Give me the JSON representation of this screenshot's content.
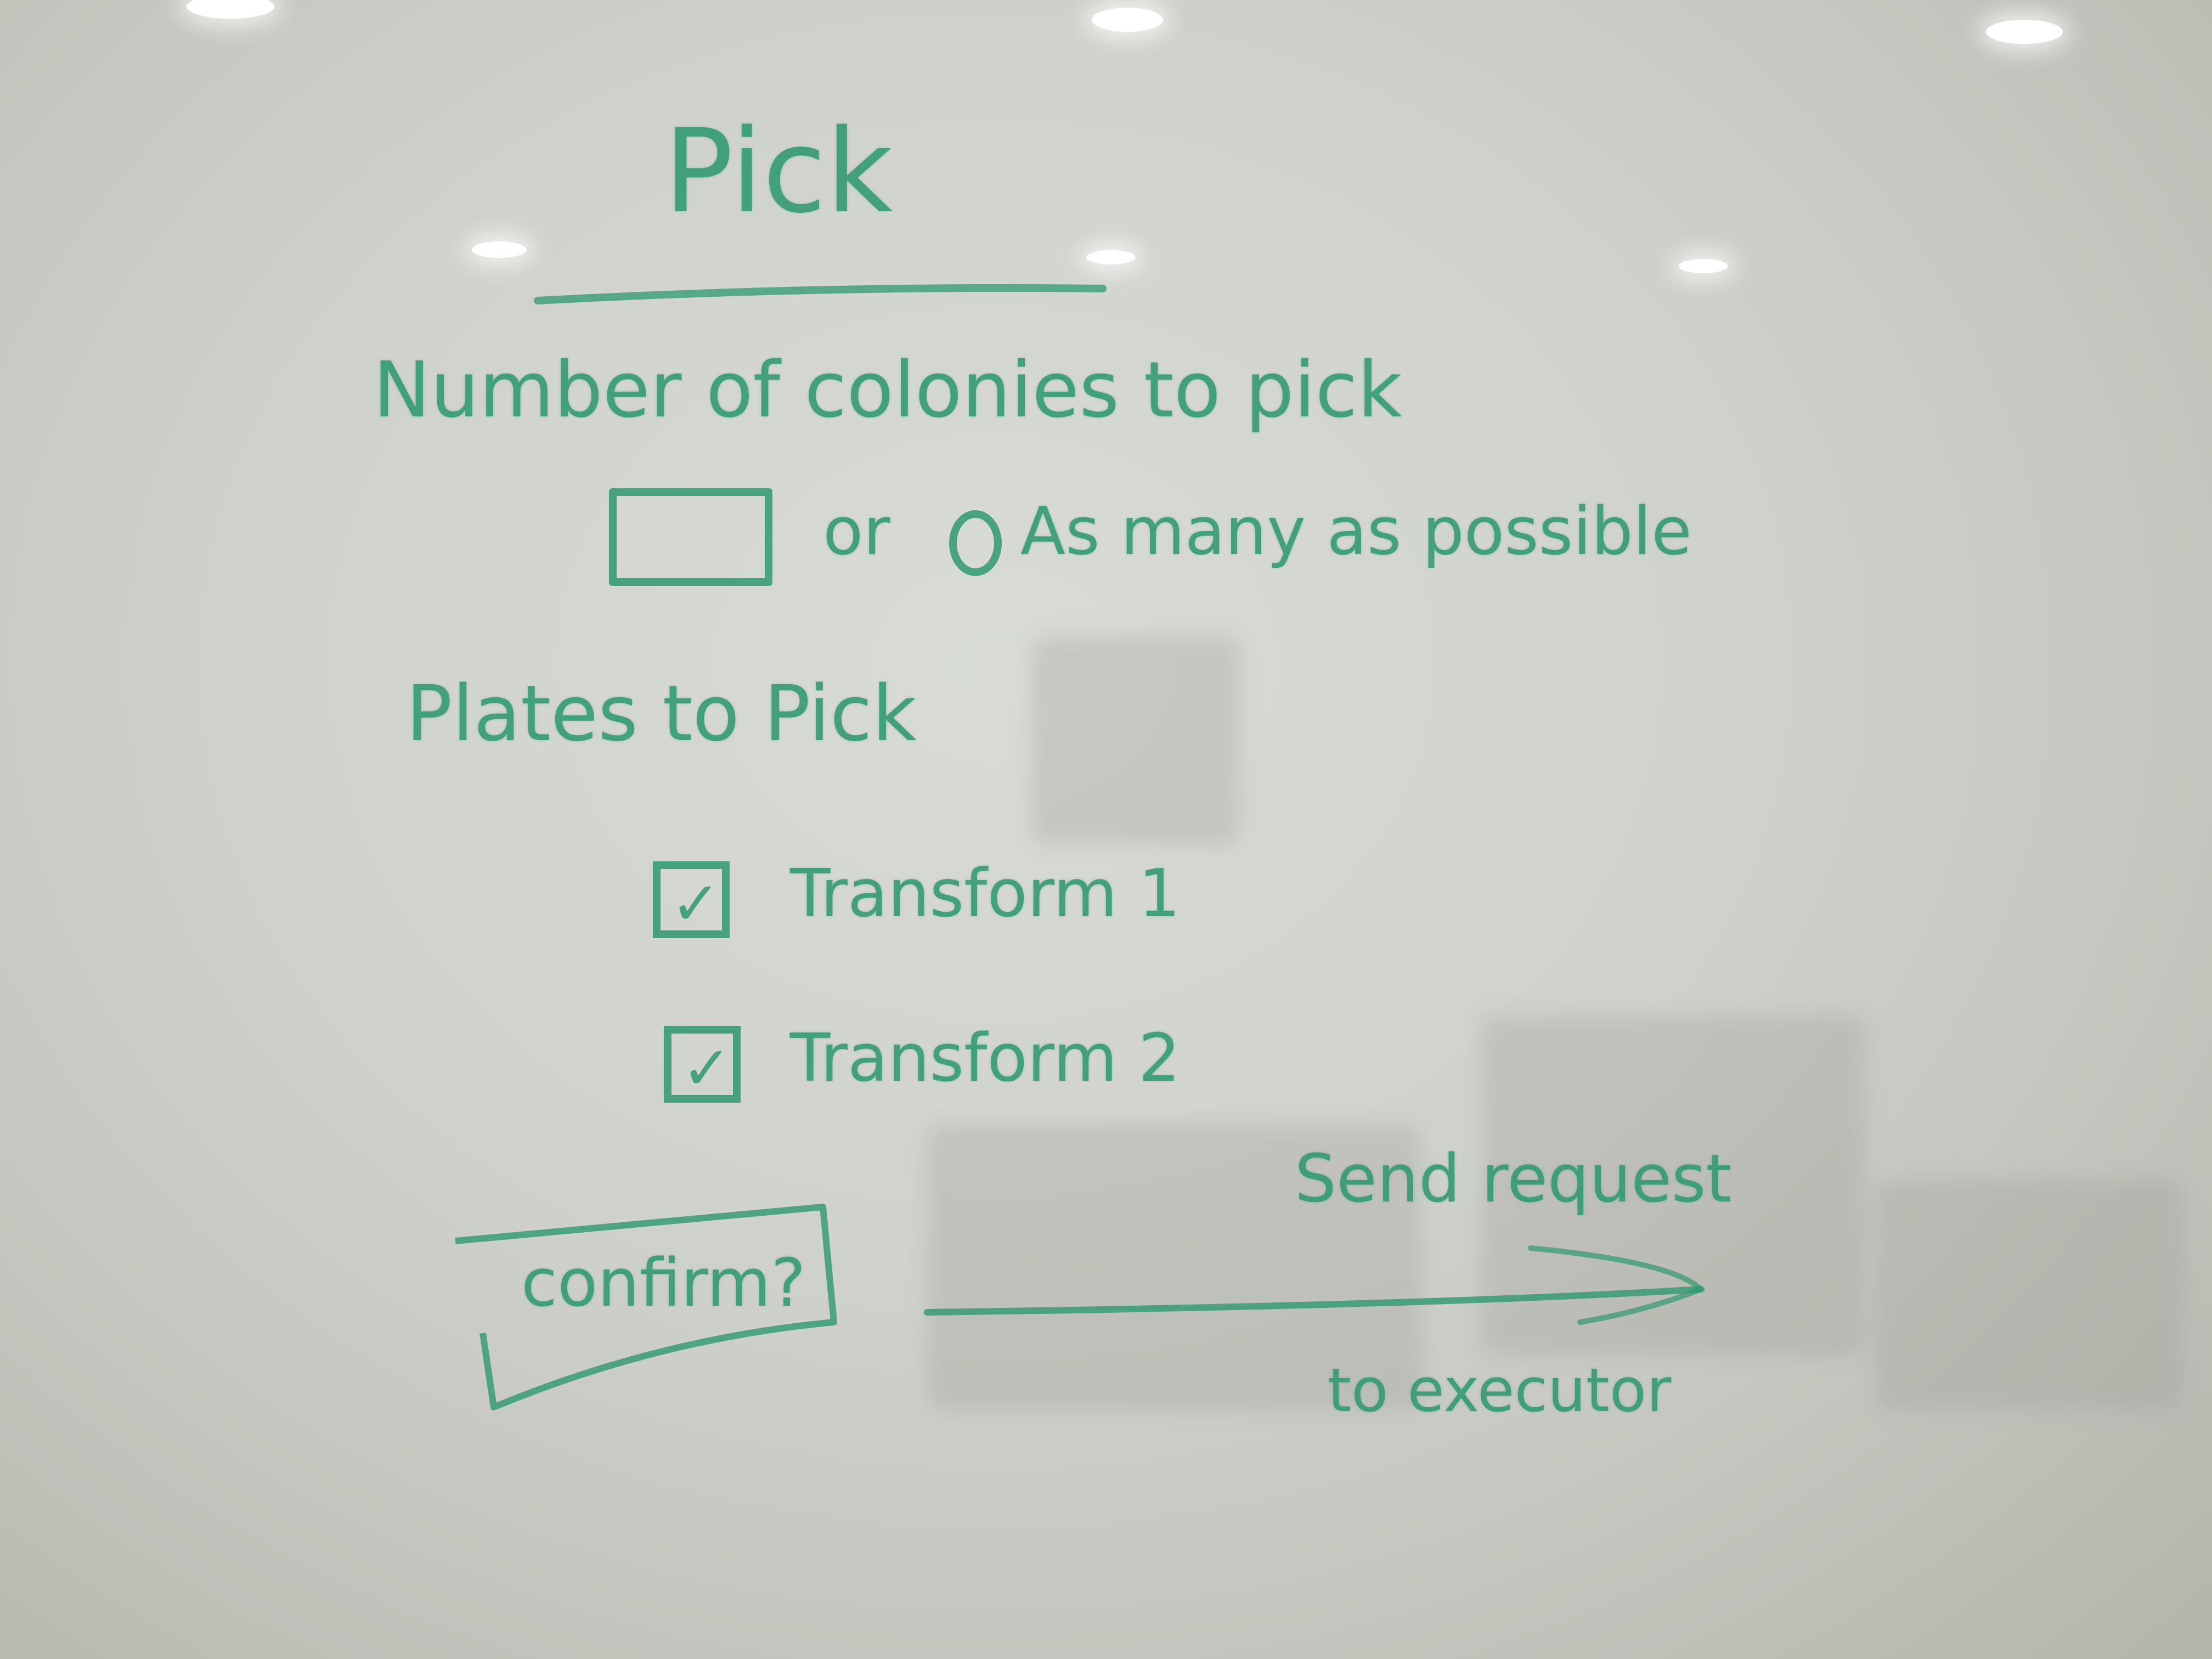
{
  "title": "Pick",
  "count_section": {
    "label": "Number of colonies to pick",
    "or_text": "or",
    "max_option_label": "As many as possible"
  },
  "plates_section": {
    "label": "Plates to Pick",
    "items": [
      {
        "label": "Transform 1",
        "checked": true
      },
      {
        "label": "Transform 2",
        "checked": true
      }
    ]
  },
  "confirm_button": {
    "label": "confirm?"
  },
  "flow_note": {
    "above": "Send request",
    "below": "to executor"
  },
  "colors": {
    "ink": "#2f9a6e",
    "board": "#cfd2cb"
  }
}
